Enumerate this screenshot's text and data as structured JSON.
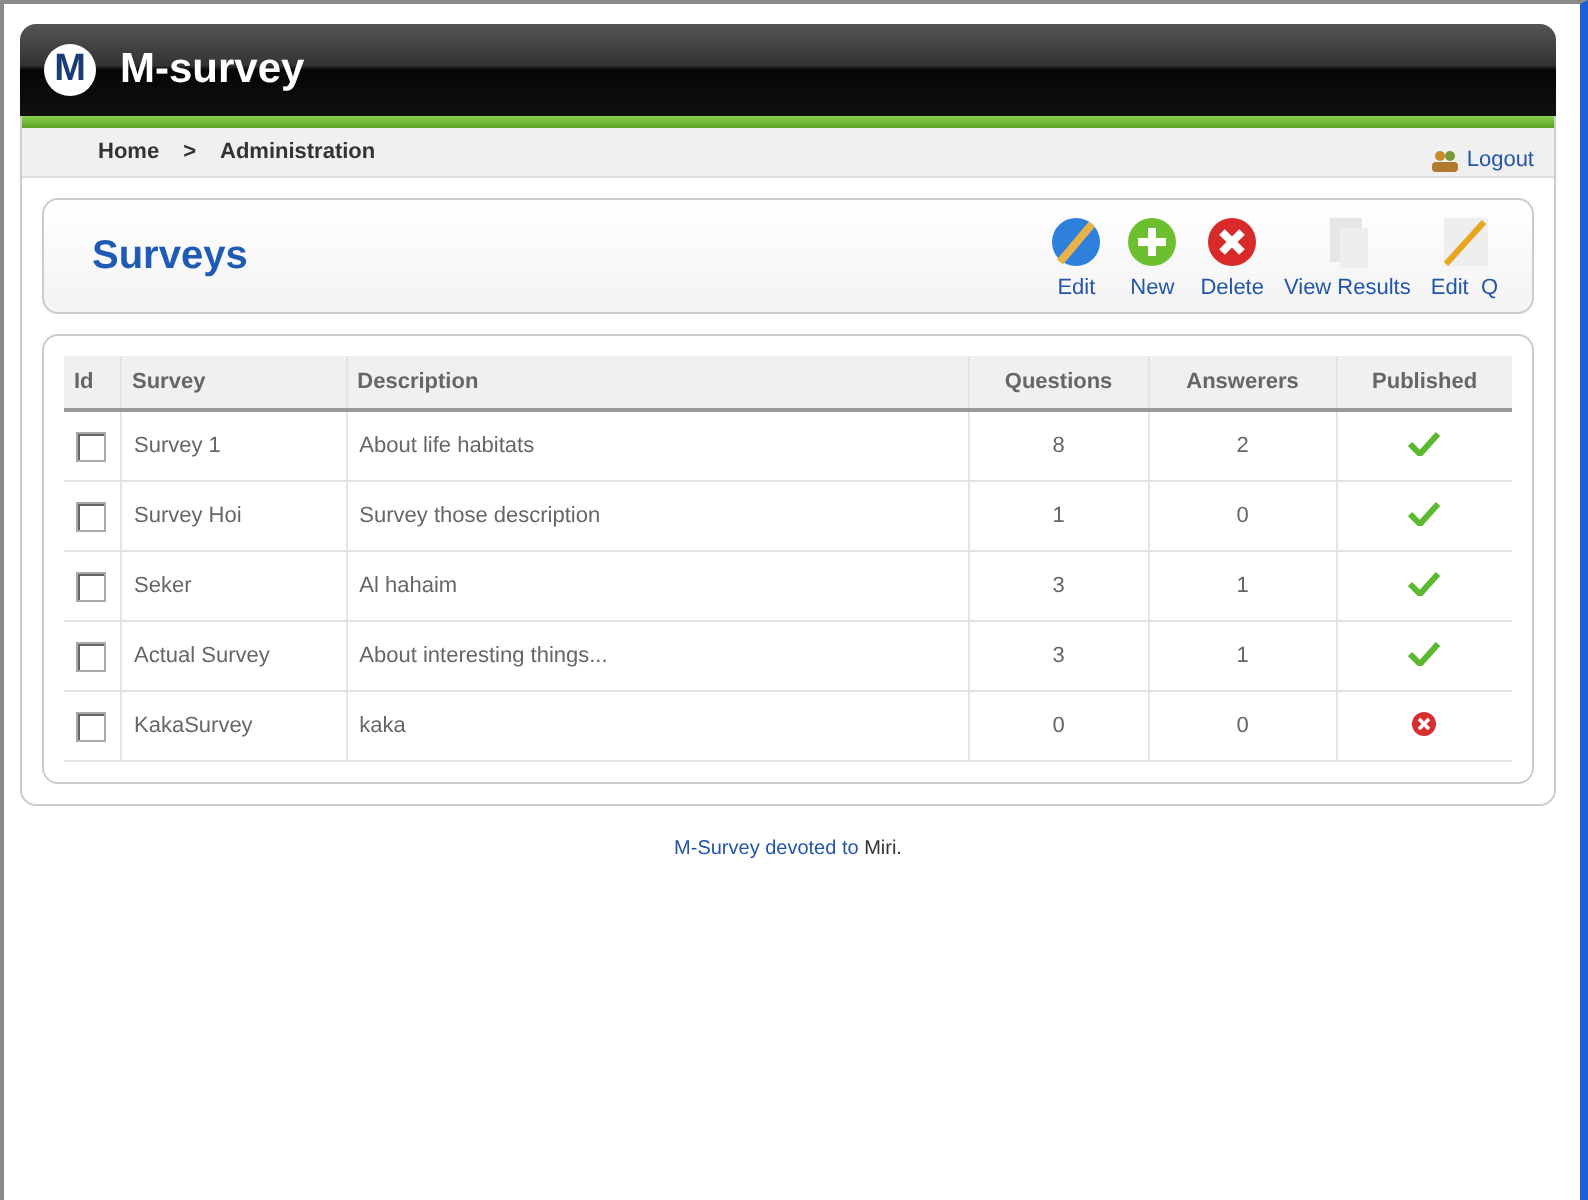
{
  "header": {
    "logo_letter": "M",
    "title": "M-survey"
  },
  "breadcrumb": [
    "Home",
    ">",
    "Administration"
  ],
  "logout": "Logout",
  "toolbar": {
    "title": "Surveys",
    "buttons": [
      {
        "label": "Edit",
        "kind": "edit"
      },
      {
        "label": "New",
        "kind": "new"
      },
      {
        "label": "Delete",
        "kind": "delete"
      },
      {
        "label": "View Results",
        "kind": "results"
      },
      {
        "label": "Edit  Q",
        "kind": "editq"
      }
    ]
  },
  "table": {
    "columns": [
      "Id",
      "Survey",
      "Description",
      "Questions",
      "Answerers",
      "Published"
    ],
    "rows": [
      {
        "checked": false,
        "survey": "Survey 1",
        "description": "About life habitats",
        "questions": "8",
        "answerers": "2",
        "published": true
      },
      {
        "checked": false,
        "survey": "Survey Hoi",
        "description": "Survey those description",
        "questions": "1",
        "answerers": "0",
        "published": true
      },
      {
        "checked": false,
        "survey": "Seker",
        "description": "Al hahaim",
        "questions": "3",
        "answerers": "1",
        "published": true
      },
      {
        "checked": false,
        "survey": "Actual Survey",
        "description": "About interesting things...",
        "questions": "3",
        "answerers": "1",
        "published": true
      },
      {
        "checked": false,
        "survey": "KakaSurvey",
        "description": "kaka",
        "questions": "0",
        "answerers": "0",
        "published": false
      }
    ]
  },
  "footer": {
    "text": "M-Survey devoted to",
    "name": "Miri."
  }
}
